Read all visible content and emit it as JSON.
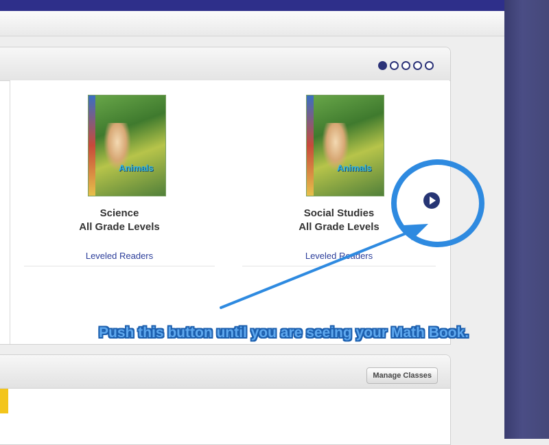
{
  "carousel": {
    "pager": {
      "count": 5,
      "active_index": 0
    },
    "tiles": [
      {
        "line1": "Science",
        "line2": "All Grade Levels",
        "link": "Leveled Readers",
        "cover_title": "Animals"
      },
      {
        "line1": "Social Studies",
        "line2": "All Grade Levels",
        "link": "Leveled Readers",
        "cover_title": "Animals"
      }
    ],
    "next_icon": "play-circle-icon"
  },
  "callout": {
    "text": "Push this button until you are seeing your Math Book.",
    "color": "#2e8ae0"
  },
  "classes": {
    "manage_label": "Manage Classes"
  },
  "colors": {
    "top_bar": "#2e2f8a",
    "pager_active": "#2c3378",
    "link": "#2b3d9a",
    "side_panel": "#454879"
  }
}
